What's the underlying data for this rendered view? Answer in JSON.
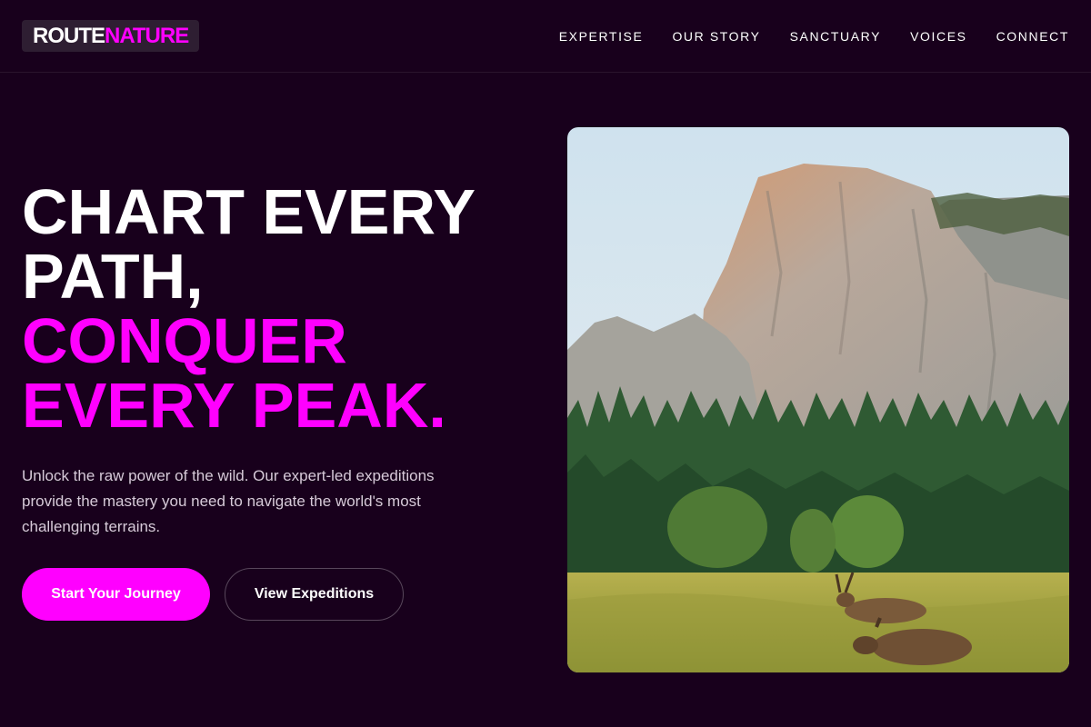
{
  "nav": {
    "logo_primary": "ROUTE",
    "logo_accent": "NATURE",
    "links": [
      "EXPERTISE",
      "OUR STORY",
      "SANCTUARY",
      "VOICES",
      "CONNECT"
    ]
  },
  "hero": {
    "title_line1": "CHART EVERY",
    "title_line2": "PATH,",
    "title_line3": "CONQUER",
    "title_line4": "EVERY PEAK.",
    "subtitle": "Unlock the raw power of the wild. Our expert-led expeditions provide the mastery you need to navigate the world's most challenging terrains.",
    "primary_cta": "Start Your Journey",
    "secondary_cta": "View Expeditions"
  },
  "colors": {
    "background": "#18001c",
    "accent": "#ff00ff",
    "text": "#ffffff",
    "muted_text": "#d6cad8"
  }
}
